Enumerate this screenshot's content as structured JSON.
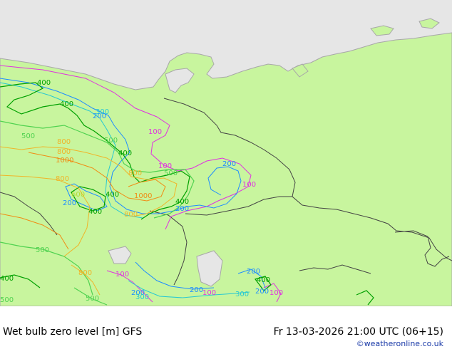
{
  "footer": {
    "title": "Wet bulb zero level [m] GFS",
    "datetime": "Fr 13-03-2026 21:00 UTC (06+15)",
    "credit": "©weatheronline.co.uk"
  },
  "colors": {
    "sea": "#e6e6e6",
    "land": "#c8f59e",
    "coast": "#a8a8a8",
    "border": "#444444",
    "c100": "#e032e0",
    "c200": "#1e8cff",
    "c300": "#28c8d2",
    "c400": "#00a000",
    "c500": "#50d250",
    "c600": "#b4dc32",
    "c800": "#f0b428",
    "c1000": "#f08c14"
  },
  "contour_labels": [
    "400",
    "400",
    "300",
    "200",
    "500",
    "800",
    "800",
    "1000",
    "500",
    "400",
    "800",
    "500",
    "800",
    "1000",
    "400",
    "400",
    "400",
    "500",
    "800",
    "600",
    "100",
    "100",
    "200",
    "100",
    "200",
    "200",
    "400",
    "500",
    "800",
    "500",
    "200",
    "300",
    "200",
    "100",
    "400",
    "200",
    "300",
    "200",
    "100",
    "100"
  ]
}
